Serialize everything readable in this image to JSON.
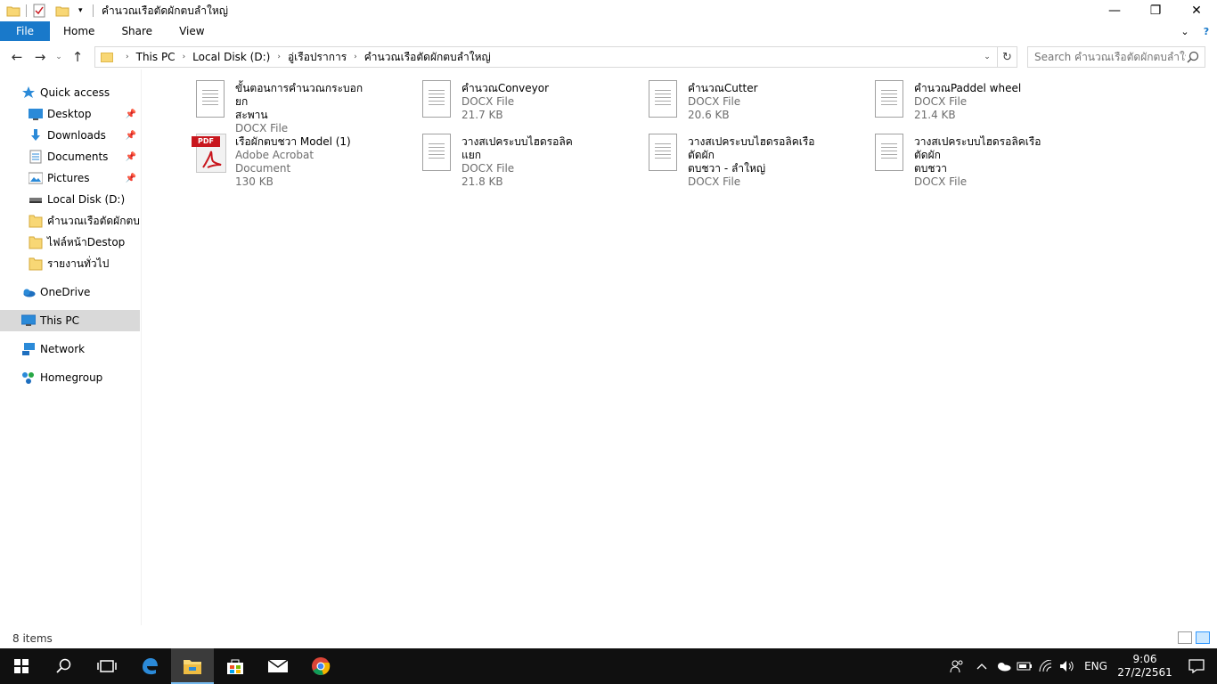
{
  "window": {
    "title": "คำนวณเรือตัดผักตบลำใหญ่",
    "minimize": "—",
    "maximize": "❐",
    "close": "✕"
  },
  "ribbon": {
    "tabs": [
      "File",
      "Home",
      "Share",
      "View"
    ],
    "expand_icon": "chevron-down-icon",
    "help_icon": "help-icon"
  },
  "address": {
    "crumbs": [
      "This PC",
      "Local Disk (D:)",
      "อู่เรือปราการ",
      "คำนวณเรือตัดผักตบลำใหญ่"
    ],
    "search_placeholder": "Search คำนวณเรือตัดผักตบลำใหญ่"
  },
  "nav": {
    "quick_access": "Quick access",
    "pinned": [
      {
        "label": "Desktop",
        "icon": "desktop-icon"
      },
      {
        "label": "Downloads",
        "icon": "downloads-icon"
      },
      {
        "label": "Documents",
        "icon": "documents-icon"
      },
      {
        "label": "Pictures",
        "icon": "pictures-icon"
      }
    ],
    "recent": [
      {
        "label": "Local Disk (D:)",
        "icon": "drive-icon"
      },
      {
        "label": "คำนวณเรือตัดผักตบลำ",
        "icon": "folder-icon"
      },
      {
        "label": "ไฟล์หน้าDestop",
        "icon": "folder-icon"
      },
      {
        "label": "รายงานทั่วไป",
        "icon": "folder-icon"
      }
    ],
    "onedrive": "OneDrive",
    "this_pc": "This PC",
    "network": "Network",
    "homegroup": "Homegroup"
  },
  "files": [
    {
      "name_line1": "ขั้นตอนการคำนวณกระบอกยก",
      "name_line2": "สะพาน",
      "type": "DOCX File",
      "size": "",
      "icon": "docx-file-icon"
    },
    {
      "name_line1": "คำนวณConveyor",
      "name_line2": "",
      "type": "DOCX File",
      "size": "21.7 KB",
      "icon": "docx-file-icon"
    },
    {
      "name_line1": "คำนวณCutter",
      "name_line2": "",
      "type": "DOCX File",
      "size": "20.6 KB",
      "icon": "docx-file-icon"
    },
    {
      "name_line1": "คำนวณPaddel wheel",
      "name_line2": "",
      "type": "DOCX File",
      "size": "21.4 KB",
      "icon": "docx-file-icon"
    },
    {
      "name_line1": "เรือผักตบชวา Model (1)",
      "name_line2": "",
      "type": "Adobe Acrobat Document",
      "size": "130 KB",
      "icon": "pdf-file-icon"
    },
    {
      "name_line1": "วางสเปคระบบไฮดรอลิคแยก",
      "name_line2": "",
      "type": "DOCX File",
      "size": "21.8 KB",
      "icon": "docx-file-icon"
    },
    {
      "name_line1": "วางสเปคระบบไฮดรอลิคเรือตัดผัก",
      "name_line2": "ตบชวา - ลำใหญ่",
      "type": "DOCX File",
      "size": "",
      "icon": "docx-file-icon"
    },
    {
      "name_line1": "วางสเปคระบบไฮดรอลิคเรือตัดผัก",
      "name_line2": "ตบชวา",
      "type": "DOCX File",
      "size": "",
      "icon": "docx-file-icon"
    }
  ],
  "pdf_badge": "PDF",
  "status": {
    "item_count": "8 items"
  },
  "taskbar": {
    "language": "ENG",
    "time": "9:06",
    "date": "27/2/2561"
  },
  "colors": {
    "file_tab": "#1979ca",
    "taskbar": "#101010",
    "selected_nav": "#d9d9d9"
  }
}
